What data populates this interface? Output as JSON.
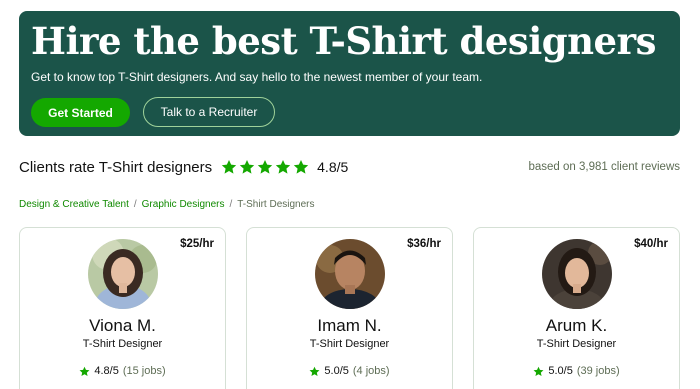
{
  "hero": {
    "title": "Hire the best T-Shirt designers",
    "subtitle": "Get to know top T-Shirt designers. And say hello to the newest member of your team.",
    "primary_button": "Get Started",
    "secondary_button": "Talk to a Recruiter"
  },
  "rating": {
    "label": "Clients rate T-Shirt designers",
    "stars": 5,
    "value": "4.8/5",
    "reviews": "based on 3,981 client reviews"
  },
  "breadcrumb": {
    "items": [
      "Design & Creative Talent",
      "Graphic Designers",
      "T-Shirt Designers"
    ],
    "separator": "/"
  },
  "freelancers": [
    {
      "rate": "$25/hr",
      "name": "Viona M.",
      "title": "T-Shirt Designer",
      "score": "4.8/5",
      "jobs": "(15 jobs)"
    },
    {
      "rate": "$36/hr",
      "name": "Imam N.",
      "title": "T-Shirt Designer",
      "score": "5.0/5",
      "jobs": "(4 jobs)"
    },
    {
      "rate": "$40/hr",
      "name": "Arum K.",
      "title": "T-Shirt Designer",
      "score": "5.0/5",
      "jobs": "(39 jobs)"
    }
  ],
  "colors": {
    "hero_bg": "#1b5449",
    "accent_green": "#14a800",
    "star": "#14a800",
    "link": "#108a00"
  },
  "icons": {
    "star": "star-icon"
  }
}
